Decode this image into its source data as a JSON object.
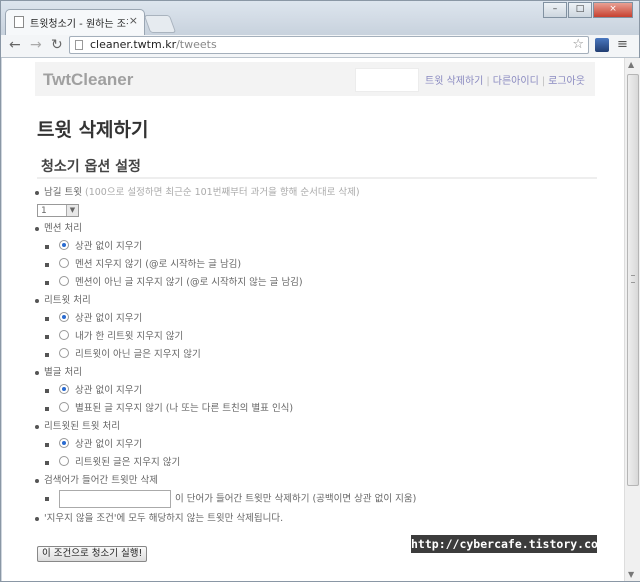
{
  "browser": {
    "tab_title": "트윗청소기 - 원하는 조건",
    "tab_close": "×",
    "window_buttons": [
      "–",
      "□",
      "×"
    ],
    "url_host": "cleaner.twtm.kr",
    "url_path": "/tweets",
    "icons": {
      "back": "back-arrow-icon",
      "forward": "forward-arrow-icon",
      "reload": "reload-icon",
      "star": "bookmark-star-icon",
      "menu": "wrench-menu-icon"
    }
  },
  "header": {
    "brand": "TwtCleaner",
    "links": [
      "트윗 삭제하기",
      "다른아이디",
      "로그아웃"
    ]
  },
  "page": {
    "title": "트윗 삭제하기",
    "section": "청소기 옵션 설정"
  },
  "options": {
    "old_tweets": {
      "label": "남길 트윗",
      "note": "(100으로 설정하면 최근순 101번째부터 과거을 향해 순서대로 삭제)",
      "select_value": "1"
    },
    "mention": {
      "label": "멘션 처리",
      "choices": [
        "상관 없이 지우기",
        "멘션 지우지 않기 (@로 시작하는 글 남김)",
        "멘션이 아닌 글 지우지 않기 (@로 시작하지 않는 글 남김)"
      ],
      "selected": 0
    },
    "retweet": {
      "label": "리트윗 처리",
      "choices": [
        "상관 없이 지우기",
        "내가 한 리트윗 지우지 않기",
        "리트윗이 아닌 글은 지우지 않기"
      ],
      "selected": 0
    },
    "star": {
      "label": "별글 처리",
      "choices": [
        "상관 없이 지우기",
        "별표된 글 지우지 않기 (나 또는 다른 트친의 별표 인식)"
      ],
      "selected": 0
    },
    "retweeted": {
      "label": "리트윗된 트윗 처리",
      "choices": [
        "상관 없이 지우기",
        "리트윗된 글은 지우지 않기"
      ],
      "selected": 0
    },
    "keyword": {
      "label": "검색어가 들어간 트윗만 삭제",
      "input_value": "",
      "hint": "이 단어가 들어간 트윗만 삭제하기 (공백이면 상관 없이 지움)"
    },
    "footer_note": "'지우지 않을 조건'에 모두 해당하지 않는 트윗만 삭제됩니다."
  },
  "run_button": "이 조건으로 청소기 실행!",
  "watermark": "http://cybercafe.tistory.com"
}
